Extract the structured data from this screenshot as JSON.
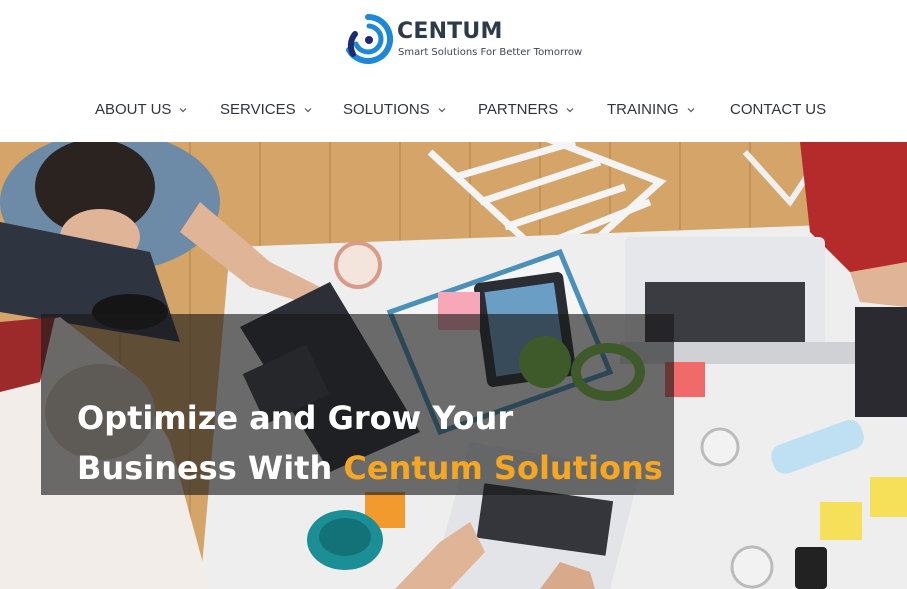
{
  "brand": {
    "name": "CENTUM",
    "tagline": "Smart Solutions For Better Tomorrow",
    "colors": {
      "logo_blue": "#1e88d8",
      "logo_navy": "#1c2a78",
      "text_dark": "#2e3a4a"
    }
  },
  "nav": {
    "items": [
      {
        "label": "ABOUT US",
        "has_dropdown": true,
        "icon": "chevron-down-icon"
      },
      {
        "label": "SERVICES",
        "has_dropdown": true,
        "icon": "chevron-down-icon"
      },
      {
        "label": "SOLUTIONS",
        "has_dropdown": true,
        "icon": "chevron-down-icon"
      },
      {
        "label": "PARTNERS",
        "has_dropdown": true,
        "icon": "chevron-down-icon"
      },
      {
        "label": "TRAINING",
        "has_dropdown": true,
        "icon": "chevron-down-icon"
      },
      {
        "label": "CONTACT US",
        "has_dropdown": false
      }
    ]
  },
  "hero": {
    "line1": "Optimize and Grow Your",
    "line2_prefix": "Business With ",
    "line2_accent": "Centum Solutions",
    "colors": {
      "accent": "#f5a623",
      "overlay": "#191919",
      "text": "#ffffff"
    }
  }
}
